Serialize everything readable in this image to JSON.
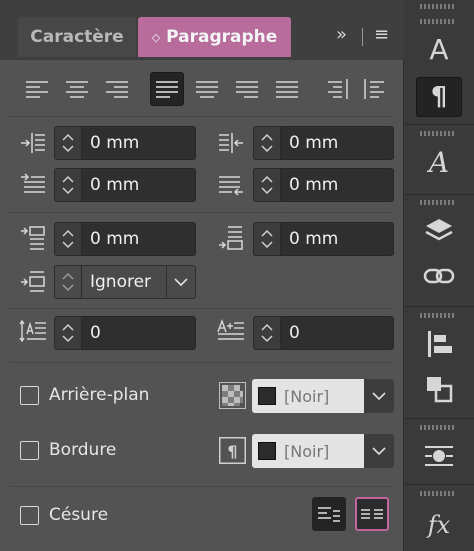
{
  "tabs": {
    "character": "Caractère",
    "paragraph": "Paragraphe",
    "paragraph_chevron": "◇",
    "overflow": "»",
    "menu": "≡"
  },
  "fields": {
    "left_indent": "0 mm",
    "right_indent": "0 mm",
    "first_line_indent": "0 mm",
    "last_line_indent": "0 mm",
    "space_before": "0 mm",
    "space_after": "0 mm",
    "align_to_grid": "Ignorer",
    "drop_cap_lines": "0",
    "drop_cap_chars": "0"
  },
  "options": {
    "background_label": "Arrière-plan",
    "background_color": "[Noir]",
    "border_label": "Bordure",
    "border_color": "[Noir]",
    "hyphenation_label": "Césure"
  },
  "sidebar": {
    "character": "A",
    "paragraph": "¶",
    "char_styles": "A",
    "fx": "fx"
  },
  "colors": {
    "accent": "#b76c9b",
    "panel": "#535353",
    "field": "#2f2f2f"
  }
}
